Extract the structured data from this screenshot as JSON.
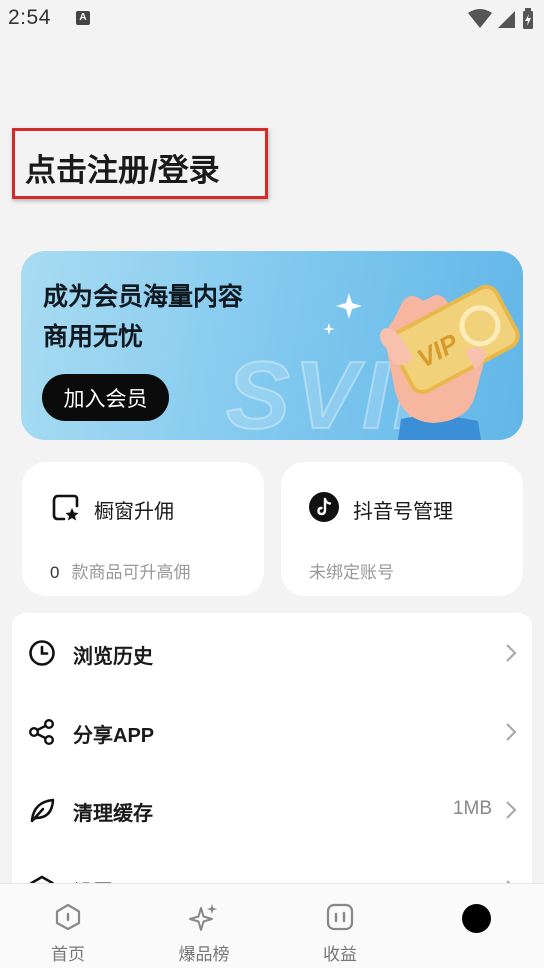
{
  "status_bar": {
    "time": "2:54",
    "notification_icon": "A"
  },
  "login": {
    "title": "点击注册/登录"
  },
  "vip_banner": {
    "line1": "成为会员海量内容",
    "line2": "商用无忧",
    "join_button": "加入会员",
    "watermark": "SVIP",
    "card_text": "VIP"
  },
  "cards": [
    {
      "icon": "shop-star-icon",
      "title": "橱窗升佣",
      "count": "0",
      "subtitle": "款商品可升高佣"
    },
    {
      "icon": "tiktok-icon",
      "title": "抖音号管理",
      "subtitle": "未绑定账号"
    }
  ],
  "menu": [
    {
      "icon": "clock-icon",
      "label": "浏览历史",
      "value": ""
    },
    {
      "icon": "share-icon",
      "label": "分享APP",
      "value": ""
    },
    {
      "icon": "leaf-icon",
      "label": "清理缓存",
      "value": "1MB"
    },
    {
      "icon": "settings-icon",
      "label": "设置",
      "value": ""
    }
  ],
  "bottom_nav": [
    {
      "icon": "home-icon",
      "label": "首页"
    },
    {
      "icon": "sparkle-icon",
      "label": "爆品榜"
    },
    {
      "icon": "earnings-icon",
      "label": "收益"
    },
    {
      "icon": "profile-icon",
      "label": ""
    }
  ],
  "colors": {
    "accent_dark": "#0b0b0b",
    "banner_blue": "#7ec7ee",
    "highlight_red": "#d42a2a"
  }
}
